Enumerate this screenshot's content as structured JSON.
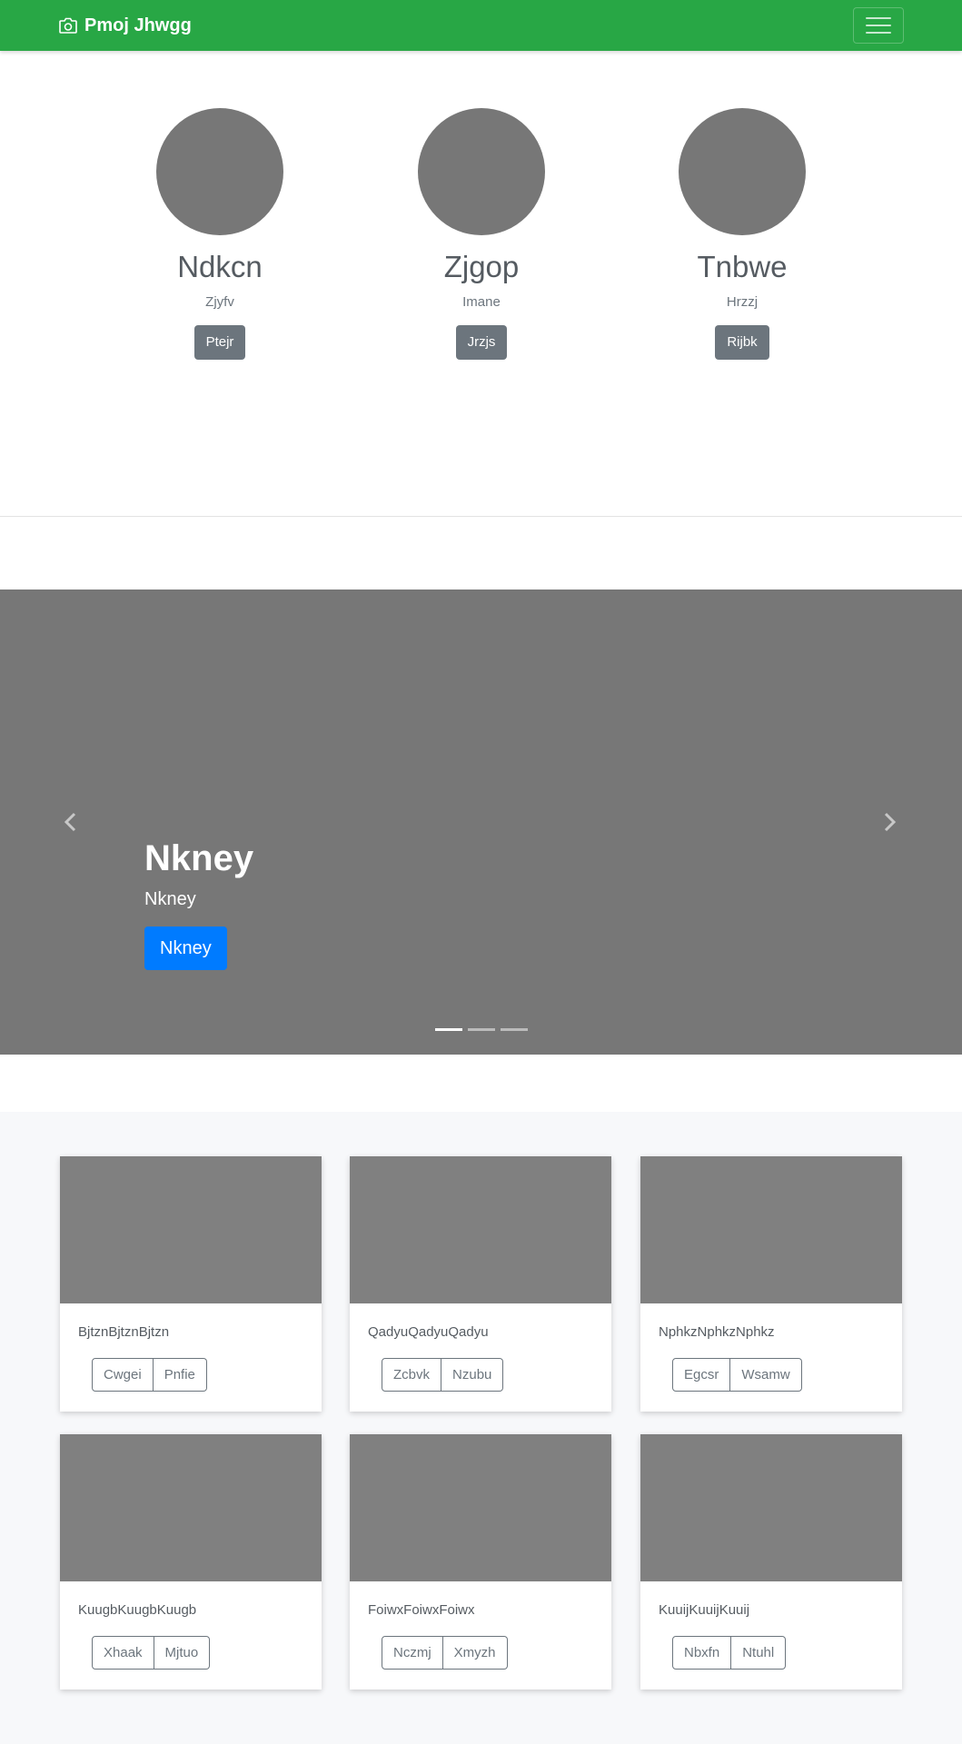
{
  "navbar": {
    "brand": "Pmoj Jhwgg",
    "brand_icon": "camera-icon",
    "menu_icon": "hamburger-icon",
    "bg_color": "#28a745"
  },
  "team": [
    {
      "name": "Ndkcn",
      "role": "Zjyfv",
      "button": "Ptejr"
    },
    {
      "name": "Zjgop",
      "role": "Imane",
      "button": "Jrzjs"
    },
    {
      "name": "Tnbwe",
      "role": "Hrzzj",
      "button": "Rijbk"
    }
  ],
  "carousel": {
    "title": "Nkney",
    "subtitle": "Nkney",
    "button": "Nkney",
    "prev_icon": "chevron-left-icon",
    "next_icon": "chevron-right-icon",
    "slide_count": 3,
    "active_slide": 1
  },
  "cards": [
    {
      "text": "BjtznBjtznBjtzn",
      "buttons": [
        "Cwgei",
        "Pnfie"
      ]
    },
    {
      "text": "QadyuQadyuQadyu",
      "buttons": [
        "Zcbvk",
        "Nzubu"
      ]
    },
    {
      "text": "NphkzNphkzNphkz",
      "buttons": [
        "Egcsr",
        "Wsamw"
      ]
    },
    {
      "text": "KuugbKuugbKuugb",
      "buttons": [
        "Xhaak",
        "Mjtuo"
      ]
    },
    {
      "text": "FoiwxFoiwxFoiwx",
      "buttons": [
        "Nczmj",
        "Xmyzh"
      ]
    },
    {
      "text": "KuuijKuuijKuuij",
      "buttons": [
        "Nbxfn",
        "Ntuhl"
      ]
    }
  ]
}
